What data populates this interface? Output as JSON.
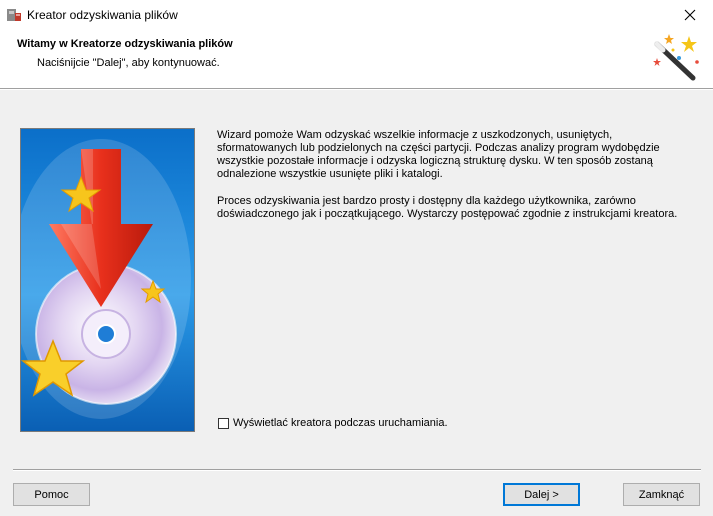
{
  "window": {
    "title": "Kreator odzyskiwania plików"
  },
  "header": {
    "title": "Witamy w Kreatorze odzyskiwania plików",
    "subtitle": "Naciśnijcie \"Dalej\", aby kontynuować."
  },
  "body": {
    "paragraph1": "Wizard pomoże Wam odzyskać wszelkie informacje z uszkodzonych, usuniętych, sformatowanych lub podzielonych na części partycji. Podczas analizy program wydobędzie wszystkie pozostałe informacje i odzyska logiczną strukturę dysku. W ten sposób zostaną odnalezione wszystkie usunięte pliki i katalogi.",
    "paragraph2": "Proces odzyskiwania jest bardzo prosty i dostępny dla każdego użytkownika, zarówno doświadczonego jak i początkującego. Wystarczy postępować zgodnie z instrukcjami kreatora."
  },
  "options": {
    "show_wizard_label": "Wyświetlać kreatora podczas uruchamiania.",
    "show_wizard_checked": false
  },
  "buttons": {
    "help": "Pomoc",
    "next": "Dalej >",
    "close": "Zamknąć"
  }
}
